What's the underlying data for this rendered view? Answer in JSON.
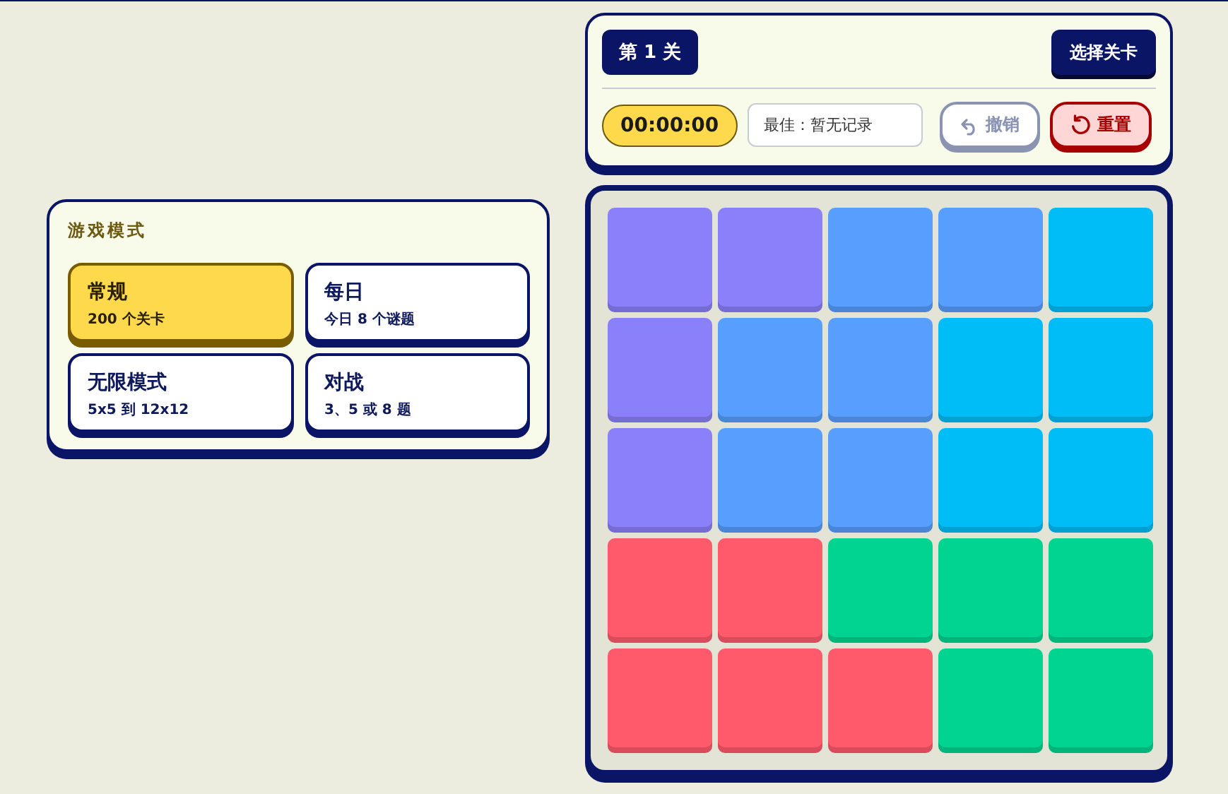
{
  "mode_panel": {
    "title": "游戏模式",
    "modes": [
      {
        "name": "常规",
        "detail": "200 个关卡",
        "selected": true
      },
      {
        "name": "每日",
        "detail": "今日 8 个谜题",
        "selected": false
      },
      {
        "name": "无限模式",
        "detail": "5x5 到 12x12",
        "selected": false
      },
      {
        "name": "对战",
        "detail": "3、5 或 8 题",
        "selected": false
      }
    ]
  },
  "header": {
    "level": "第 1 关",
    "select_level": "选择关卡",
    "timer": "00:00:00",
    "best": "最佳：暂无记录",
    "undo": {
      "label": "撤销",
      "disabled": true
    },
    "reset": "重置"
  },
  "board": {
    "rows": [
      [
        {
          "color": "#8a80f9"
        },
        {
          "color": "#8a80f9"
        },
        {
          "color": "#589efe"
        },
        {
          "color": "#589efe"
        },
        {
          "color": "#00bdf8"
        }
      ],
      [
        {
          "color": "#8a80f9"
        },
        {
          "color": "#589efe"
        },
        {
          "color": "#589efe"
        },
        {
          "color": "#00bdf8"
        },
        {
          "color": "#00bdf8"
        }
      ],
      [
        {
          "color": "#8a80f9"
        },
        {
          "color": "#589efe"
        },
        {
          "color": "#589efe"
        },
        {
          "color": "#00bdf8"
        },
        {
          "color": "#00bdf8"
        }
      ],
      [
        {
          "color": "#fe5a6b"
        },
        {
          "color": "#fe5a6b"
        },
        {
          "color": "#00d490"
        },
        {
          "color": "#00d490"
        },
        {
          "color": "#00d490"
        }
      ],
      [
        {
          "color": "#fe5a6b"
        },
        {
          "color": "#fe5a6b"
        },
        {
          "color": "#fe5a6b"
        },
        {
          "color": "#00d490"
        },
        {
          "color": "#00d490"
        }
      ]
    ]
  }
}
